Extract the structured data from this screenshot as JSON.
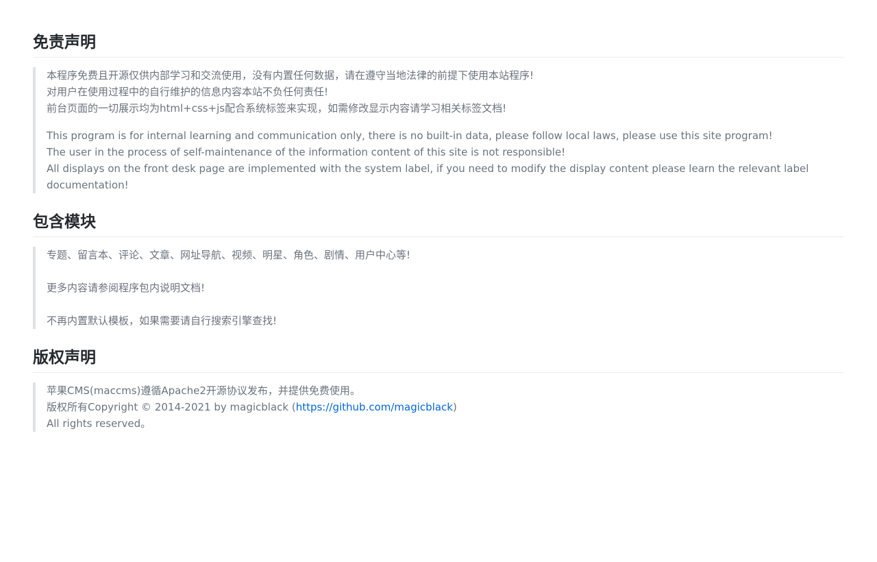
{
  "disclaimer": {
    "title": "免责声明",
    "cn_lines": [
      "本程序免费且开源仅供内部学习和交流使用，没有内置任何数据，请在遵守当地法律的前提下使用本站程序!",
      "对用户在使用过程中的自行维护的信息内容本站不负任何责任!",
      "前台页面的一切展示均为html+css+js配合系统标签来实现，如需修改显示内容请学习相关标签文档!"
    ],
    "en_lines": [
      "This program is for internal learning and communication only, there is no built-in data, please follow local laws, please use this site program!",
      "The user in the process of self-maintenance of the information content of this site is not responsible!",
      "All displays on the front desk page are implemented with the system label, if you need to modify the display content please learn the relevant label",
      "documentation!"
    ]
  },
  "modules": {
    "title": "包含模块",
    "lines": [
      "专题、留言本、评论、文章、网址导航、视频、明星、角色、剧情、用户中心等!",
      "更多内容请参阅程序包内说明文档!",
      "不再内置默认模板，如果需要请自行搜索引擎查找!"
    ]
  },
  "copyright": {
    "title": "版权声明",
    "line1": "苹果CMS(maccms)遵循Apache2开源协议发布，并提供免费使用。",
    "line2_prefix": "版权所有Copyright © 2014-2021 by magicblack (",
    "line2_link": "https://github.com/magicblack",
    "line2_suffix": ")",
    "line3": "All rights reserved。"
  }
}
